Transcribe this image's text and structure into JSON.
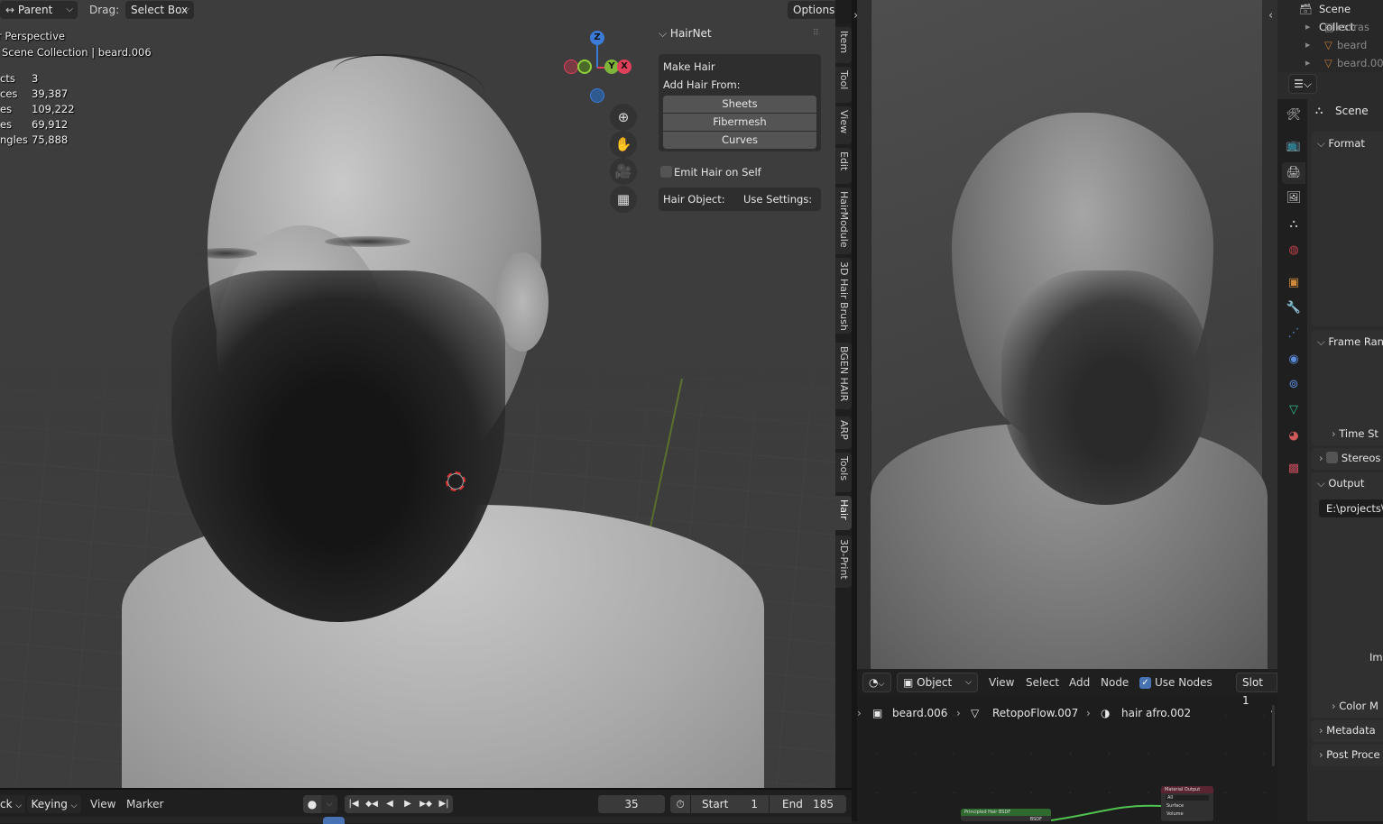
{
  "viewport": {
    "header": {
      "pivot_dropdown": "Parent",
      "drag_label": "Drag:",
      "drag_dropdown": "Select Box",
      "options_button": "Options"
    },
    "overlay": {
      "view_name": "Perspective",
      "collection_path": "Scene Collection | beard.006",
      "stats": [
        {
          "label": "cts",
          "value": "3"
        },
        {
          "label": "ces",
          "value": "39,387"
        },
        {
          "label": "es",
          "value": "109,222"
        },
        {
          "label": "es",
          "value": "69,912"
        },
        {
          "label": "ngles",
          "value": "75,888"
        }
      ]
    },
    "gizmo": {
      "z": "Z",
      "y": "Y",
      "x": "X"
    },
    "nav_icons": [
      "zoom-icon",
      "hand-pan-icon",
      "camera-icon",
      "grid-ortho-icon"
    ],
    "npanel": {
      "title": "HairNet",
      "make_hair": "Make Hair",
      "add_hair_from": "Add Hair From:",
      "buttons": [
        "Sheets",
        "Fibermesh",
        "Curves"
      ],
      "emit_hair_on_self": "Emit Hair on Self",
      "emit_checked": false,
      "hair_object_label": "Hair Object:",
      "use_settings_label": "Use Settings:"
    },
    "tabs": [
      "Item",
      "Tool",
      "View",
      "Edit",
      "HairModule",
      "3D Hair Brush",
      "BGEN HAIR",
      "ARP",
      "Tools",
      "Hair",
      "3D-Print"
    ],
    "active_tab": "Hair"
  },
  "timeline": {
    "mode_dropdown": "ck",
    "keying_dropdown": "Keying",
    "menus": [
      "View",
      "Marker"
    ],
    "current_frame": "35",
    "start_label": "Start",
    "start_value": "1",
    "end_label": "End",
    "end_value": "185"
  },
  "shader_editor": {
    "header": {
      "object_dropdown": "Object",
      "menus": [
        "View",
        "Select",
        "Add",
        "Node"
      ],
      "use_nodes_label": "Use Nodes",
      "use_nodes_checked": true,
      "slot": "Slot 1"
    },
    "breadcrumb": [
      "beard.006",
      "RetopoFlow.007",
      "hair afro.002"
    ],
    "nodes": {
      "bsdf": {
        "title": "Principled Hair BSDF",
        "output": "BSDF"
      },
      "output": {
        "title": "Material Output",
        "target": "All",
        "inputs": [
          "Surface",
          "Volume"
        ]
      }
    }
  },
  "outliner": {
    "root": "Scene Collect",
    "items": [
      {
        "name": "extras",
        "type": "collection"
      },
      {
        "name": "beard",
        "type": "mesh"
      },
      {
        "name": "beard.00",
        "type": "mesh"
      }
    ]
  },
  "properties": {
    "context": "Scene",
    "sections": [
      {
        "title": "Format",
        "expanded": true
      },
      {
        "title": "Frame Ran",
        "expanded": true
      },
      {
        "title": "Time St",
        "expanded": false
      },
      {
        "title": "Stereos",
        "expanded": false
      },
      {
        "title": "Output",
        "expanded": true
      },
      {
        "title": "Color M",
        "expanded": false
      },
      {
        "title": "Metadata",
        "expanded": false
      },
      {
        "title": "Post Proce",
        "expanded": false
      }
    ],
    "output_path": "E:\\projects\\",
    "im_label": "Im",
    "tab_icons": [
      "tool-icon",
      "render-icon",
      "output-icon",
      "view-layer-icon",
      "scene-icon",
      "world-icon",
      "object-icon",
      "modifier-icon",
      "particles-icon",
      "physics-icon",
      "constraints-icon",
      "data-icon",
      "material-icon",
      "texture-icon"
    ]
  },
  "colors": {
    "accent_blue": "#4772b3",
    "axis_x": "#e0405a",
    "axis_y": "#7fb43a",
    "axis_z": "#3a7ad8",
    "node_link_green": "#4fc24f"
  }
}
